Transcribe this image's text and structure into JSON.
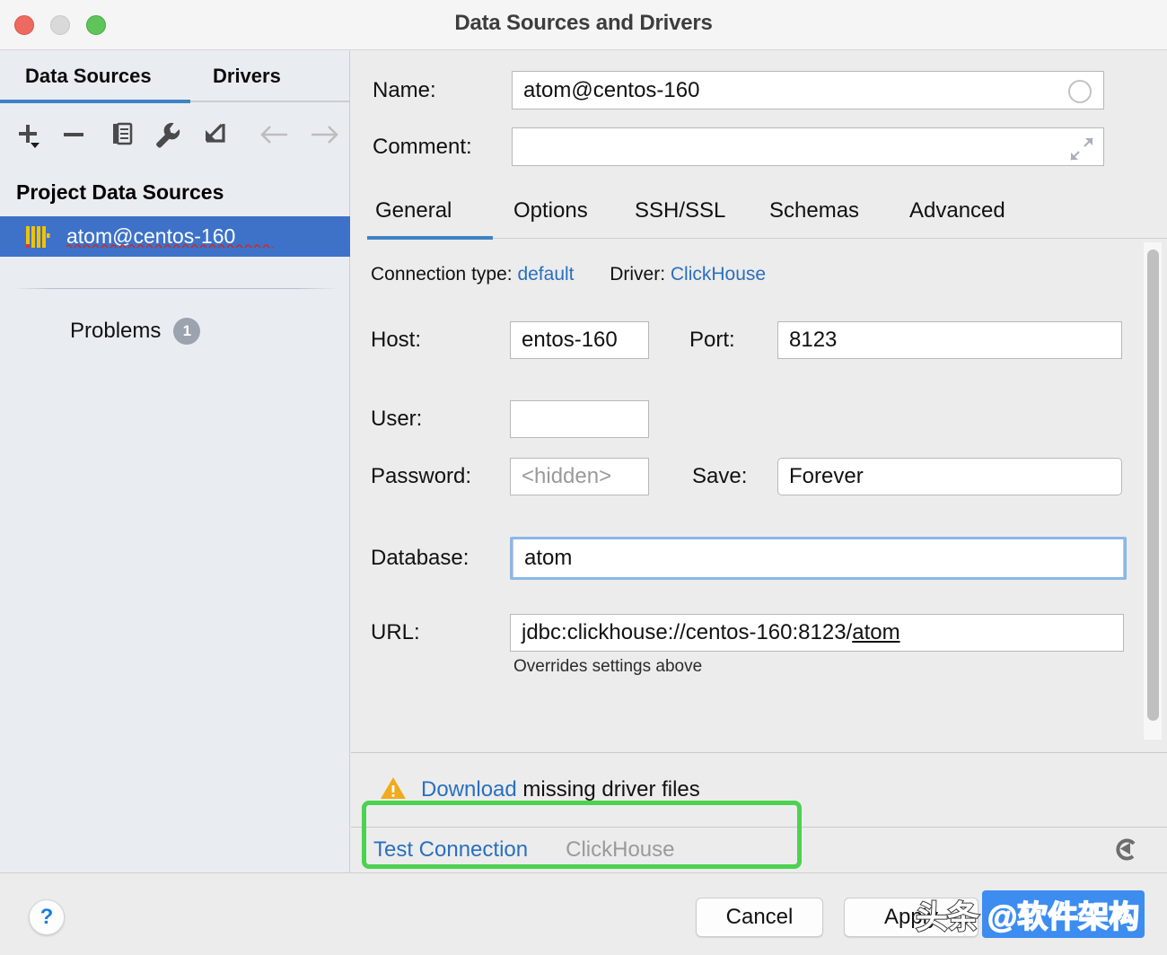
{
  "window": {
    "title": "Data Sources and Drivers",
    "traffic_lights": [
      "close",
      "minimize",
      "zoom"
    ]
  },
  "sidebar": {
    "tabs": [
      {
        "label": "Data Sources",
        "active": true
      },
      {
        "label": "Drivers",
        "active": false
      }
    ],
    "toolbar": [
      {
        "name": "add-icon",
        "glyph": "+"
      },
      {
        "name": "remove-icon",
        "glyph": "−"
      },
      {
        "name": "duplicate-icon",
        "glyph": "copy"
      },
      {
        "name": "wrench-icon",
        "glyph": "wrench"
      },
      {
        "name": "import-icon",
        "glyph": "arrow-down-left"
      },
      {
        "name": "back-arrow-icon",
        "glyph": "←"
      },
      {
        "name": "forward-arrow-icon",
        "glyph": "→"
      }
    ],
    "section_title": "Project Data Sources",
    "items": [
      {
        "label": "atom@centos-160",
        "selected": true,
        "icon": "clickhouse-icon",
        "has_error": true
      }
    ],
    "problems": {
      "label": "Problems",
      "count": "1"
    }
  },
  "form": {
    "name": {
      "label": "Name:",
      "value": "atom@centos-160"
    },
    "comment": {
      "label": "Comment:",
      "value": "",
      "placeholder": ""
    },
    "tabs": [
      {
        "label": "General",
        "active": true
      },
      {
        "label": "Options",
        "active": false
      },
      {
        "label": "SSH/SSL",
        "active": false
      },
      {
        "label": "Schemas",
        "active": false
      },
      {
        "label": "Advanced",
        "active": false
      }
    ],
    "connection_type": {
      "label": "Connection type:",
      "value": "default"
    },
    "driver": {
      "label": "Driver:",
      "value": "ClickHouse"
    },
    "host": {
      "label": "Host:",
      "value": "entos-160"
    },
    "port": {
      "label": "Port:",
      "value": "8123"
    },
    "user": {
      "label": "User:",
      "value": ""
    },
    "password": {
      "label": "Password:",
      "value": "",
      "placeholder": "<hidden>"
    },
    "save": {
      "label": "Save:",
      "value": "Forever"
    },
    "database": {
      "label": "Database:",
      "value": "atom",
      "focused": true
    },
    "url": {
      "label": "URL:",
      "value_prefix": "jdbc:clickhouse://centos-160:8123/",
      "value_suffix": "atom",
      "hint": "Overrides settings above"
    },
    "driver_warning": {
      "link_text": "Download",
      "rest_text": " missing driver files",
      "icon": "warning-triangle-icon",
      "highlight_color": "#4bd250"
    },
    "test_connection": {
      "label": "Test Connection"
    },
    "driver_status": {
      "label": "ClickHouse"
    },
    "revert": {
      "name": "revert-icon"
    }
  },
  "footer": {
    "help": {
      "label": "?"
    },
    "cancel": {
      "label": "Cancel"
    },
    "apply": {
      "label": "Apply"
    }
  },
  "watermark": {
    "text": "头条",
    "handle": "@软件架构"
  },
  "colors": {
    "accent": "#4182c4",
    "selection": "#3d72c8",
    "link": "#2a6fbd",
    "highlight": "#4bd250",
    "warning": "#f0ab1d",
    "window_bg": "#ececed",
    "sidebar_bg": "#e9edf2"
  }
}
